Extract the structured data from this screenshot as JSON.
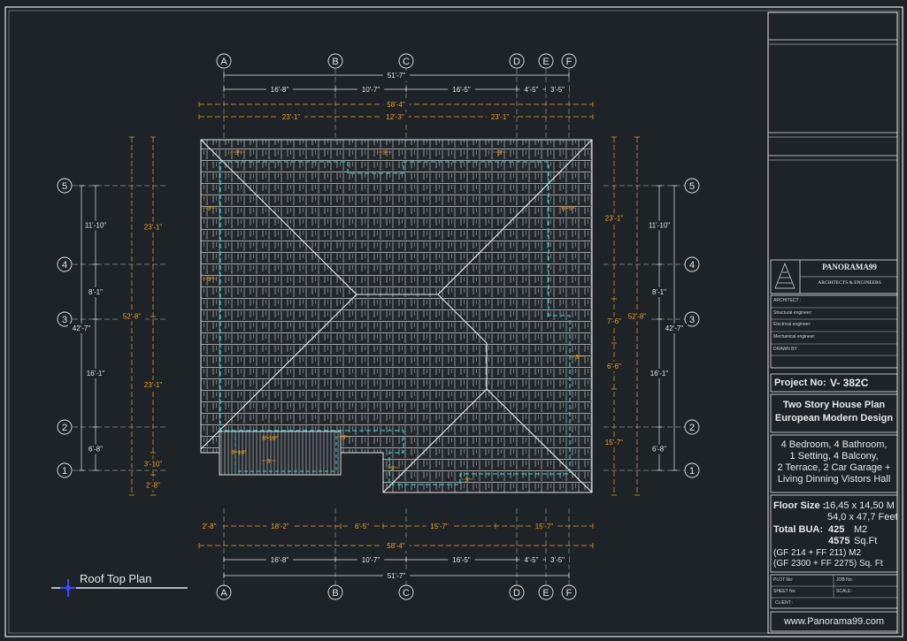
{
  "plan_title": "Roof Top Plan",
  "grid_columns": [
    "A",
    "B",
    "C",
    "D",
    "E",
    "F"
  ],
  "grid_rows": [
    "5",
    "4",
    "3",
    "2",
    "1"
  ],
  "dimensions": {
    "top_overall": "51'-7\"",
    "top_segments": [
      "16'-8\"",
      "10'-7\"",
      "16'-5\"",
      "4'-5\"",
      "3'-5\""
    ],
    "top_roof_overall": "58'-4\"",
    "top_roof_segments": [
      "23'-1\"",
      "12'-3\"",
      "23'-1\""
    ],
    "bottom_roof_segments": [
      "2'-8\"",
      "18'-2\"",
      "6'-5\"",
      "15'-7\"",
      "15'-7\""
    ],
    "bottom_roof_overall": "58'-4\"",
    "bottom_segments": [
      "16'-8\"",
      "10'-7\"",
      "16'-5\"",
      "4'-5\"",
      "3'-5\""
    ],
    "bottom_overall": "51'-7\"",
    "left_rows": [
      "11'-10\"",
      "8'-1\"",
      "16'-1\"",
      "6'-8\""
    ],
    "left_overall": "42'-7\"",
    "left_roof_overall": "52'-8\"",
    "left_roof_segments": [
      "23'-1\"",
      "23'-1\"",
      "3'-10\"",
      "2'-8\""
    ],
    "right_rows": [
      "11'-10\"",
      "8'-1\"",
      "16'-1\"",
      "6'-8\""
    ],
    "right_overall": "42'-7\"",
    "right_roof_overall": "52'-8\"",
    "right_roof_segments": [
      "23'-1\"",
      "7'-6\"",
      "6'-6\"",
      "15'-7\""
    ],
    "inner_labels": [
      "3'",
      "3'",
      "3'",
      "3'",
      "3'",
      "3'",
      "6'-5\"",
      "3'",
      "6'-10\"",
      "3'-10\"",
      "3'",
      "3'",
      "3'"
    ]
  },
  "title_block": {
    "company": "PANORAMA99",
    "company_sub": "ARCHITECTS & ENGINEERS",
    "credits": [
      "ARCHITECT :",
      "Structural engineer:",
      "Electrical engineer:",
      "Mechanical engineer:",
      "DRAWN BY :"
    ],
    "project_label": "Project No:",
    "project_no": "V- 382C",
    "plan_name_line1": "Two Story House Plan",
    "plan_name_line2": "European Modern Design",
    "features": [
      "4 Bedroom, 4 Bathroom,",
      "1 Setting, 4 Balcony,",
      "2 Terrace, 2 Car Garage +",
      "Living Dinning Vistors Hall"
    ],
    "floor_size_label": "Floor Size :",
    "floor_size_m": "16,45 x 14,50 M",
    "floor_size_ft": "54,0 x 47,7 Feet",
    "bua_label": "Total BUA:",
    "bua_m2": "425",
    "bua_m2_unit": "M2",
    "bua_sqft": "4575",
    "bua_sqft_unit": "Sq.Ft",
    "bua_breakdown_m": "(GF 214   + FF 211) M2",
    "bua_breakdown_ft": "(GF 2300 + FF 2275) Sq. Ft",
    "plot_no": "PLOT No:",
    "job_no": "JOB No:",
    "sheet_no": "SHEET No:",
    "scale": "SCALE:",
    "client": "CLIENT :",
    "website": "www.Panorama99.com"
  },
  "colors": {
    "background": "#1e2328",
    "line": "#e6e6e6",
    "dimension": "#f0a21c",
    "wall": "#2ee0e0",
    "grid": "#c8c8c8"
  }
}
